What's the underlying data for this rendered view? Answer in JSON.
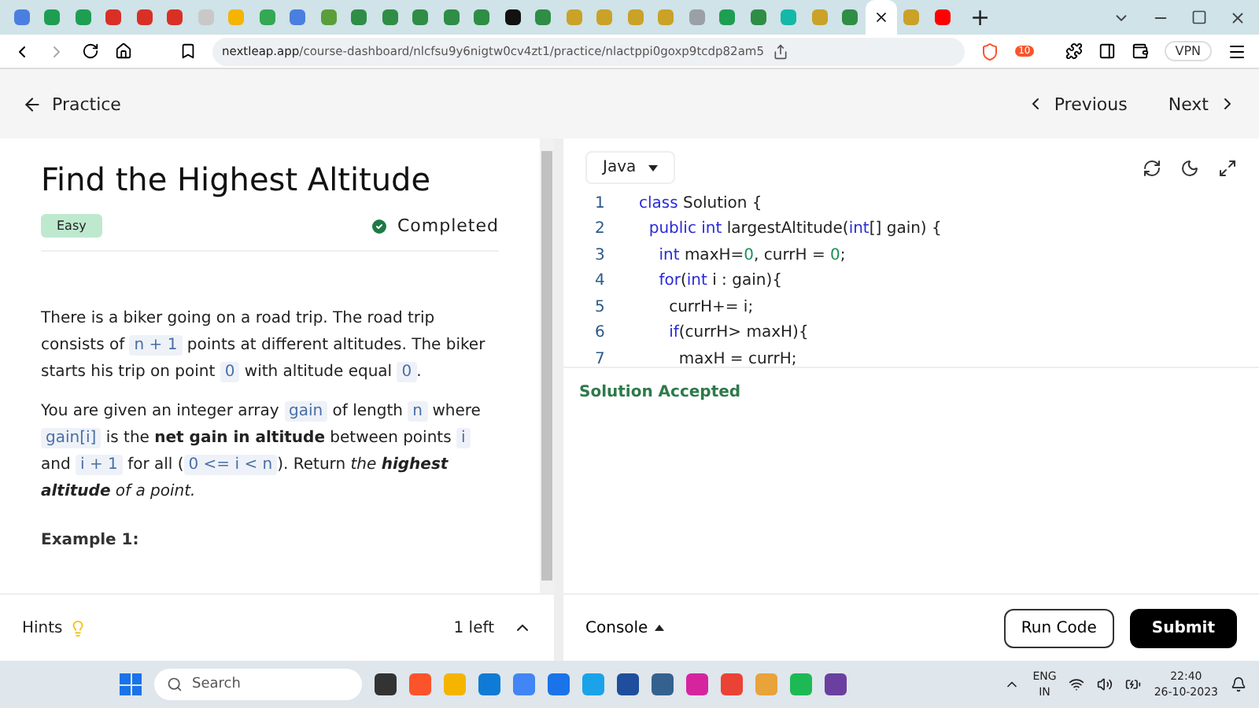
{
  "browser": {
    "tabs": [
      {
        "color": "#4a7fe0",
        "selected": false
      },
      {
        "color": "#1e9e52",
        "selected": false
      },
      {
        "color": "#1e9e52",
        "selected": false
      },
      {
        "color": "#d93025",
        "selected": false
      },
      {
        "color": "#d93025",
        "selected": false
      },
      {
        "color": "#d93025",
        "selected": false
      },
      {
        "color": "#c8c8c8",
        "selected": false
      },
      {
        "color": "#f4b400",
        "selected": false
      },
      {
        "color": "#34a853",
        "selected": false
      },
      {
        "color": "#4a7fe0",
        "selected": false
      },
      {
        "color": "#5a9e3a",
        "selected": false
      },
      {
        "color": "#2f8d46",
        "selected": false
      },
      {
        "color": "#2f8d46",
        "selected": false
      },
      {
        "color": "#2f8d46",
        "selected": false
      },
      {
        "color": "#2f8d46",
        "selected": false
      },
      {
        "color": "#2f8d46",
        "selected": false
      },
      {
        "color": "#111111",
        "selected": false
      },
      {
        "color": "#2f8d46",
        "selected": false
      },
      {
        "color": "#c9a227",
        "selected": false
      },
      {
        "color": "#c9a227",
        "selected": false
      },
      {
        "color": "#c9a227",
        "selected": false
      },
      {
        "color": "#c9a227",
        "selected": false
      },
      {
        "color": "#9aa0a6",
        "selected": false
      },
      {
        "color": "#1e9e52",
        "selected": false
      },
      {
        "color": "#2f8d46",
        "selected": false
      },
      {
        "color": "#14b8a6",
        "selected": false
      },
      {
        "color": "#c9a227",
        "selected": false
      },
      {
        "color": "#2f8d46",
        "selected": false
      },
      {
        "selected": true
      },
      {
        "color": "#c9a227",
        "selected": false
      },
      {
        "color": "#ff0000",
        "selected": false
      }
    ],
    "new_tab": "+",
    "url_host": "nextleap.app",
    "url_path": "/course-dashboard/nlcfsu9y6nigtw0cv4zt1/practice/nlactppi0goxp9tcdp82am5",
    "badge_count": "10",
    "vpn": "VPN"
  },
  "header": {
    "back": "Practice",
    "previous": "Previous",
    "next": "Next"
  },
  "problem": {
    "title": "Find the Highest Altitude",
    "difficulty": "Easy",
    "status": "Completed",
    "paragraphs": [
      [
        {
          "kind": "text",
          "text": "There is a biker going on a road trip. The road trip consists of "
        },
        {
          "kind": "code",
          "text": "n + 1"
        },
        {
          "kind": "text",
          "text": " points at different altitudes. The biker starts his trip on point "
        },
        {
          "kind": "code",
          "text": "0"
        },
        {
          "kind": "text",
          "text": " with altitude equal "
        },
        {
          "kind": "code",
          "text": "0"
        },
        {
          "kind": "text",
          "text": "."
        }
      ],
      [
        {
          "kind": "text",
          "text": "You are given an integer array "
        },
        {
          "kind": "code",
          "text": "gain"
        },
        {
          "kind": "text",
          "text": " of length "
        },
        {
          "kind": "code",
          "text": "n"
        },
        {
          "kind": "text",
          "text": " where "
        },
        {
          "kind": "code",
          "text": "gain[i]"
        },
        {
          "kind": "text",
          "text": " is the **net gain in altitude** between points "
        },
        {
          "kind": "code",
          "text": "i"
        },
        {
          "kind": "text",
          "text": " and "
        },
        {
          "kind": "code",
          "text": "i + 1"
        },
        {
          "kind": "text",
          "text": " for all ("
        },
        {
          "kind": "code",
          "text": "0 <= i < n"
        },
        {
          "kind": "text",
          "text": "). Return *the* "
        },
        {
          "kind": "strong",
          "text": "highest altitude"
        },
        {
          "kind": "text",
          "text": " *of a point.*"
        }
      ]
    ],
    "example_heading": "Example 1:"
  },
  "hints": {
    "label": "Hints",
    "count": "1 left"
  },
  "editor": {
    "language": "Java",
    "lines": [
      {
        "number": "1",
        "tokens": [
          {
            "kind": "keyword",
            "text": "class"
          },
          {
            "kind": "plain",
            "text": " Solution {"
          }
        ]
      },
      {
        "number": "2",
        "tokens": [
          {
            "kind": "keyword",
            "text": "  public int"
          },
          {
            "kind": "plain",
            "text": " largestAltitude("
          },
          {
            "kind": "keyword",
            "text": "int"
          },
          {
            "kind": "plain",
            "text": "[] gain) {"
          }
        ]
      },
      {
        "number": "3",
        "tokens": [
          {
            "kind": "keyword",
            "text": "    int"
          },
          {
            "kind": "plain",
            "text": " maxH="
          },
          {
            "kind": "number",
            "text": "0"
          },
          {
            "kind": "plain",
            "text": ", currH = "
          },
          {
            "kind": "number",
            "text": "0"
          },
          {
            "kind": "plain",
            "text": ";"
          }
        ]
      },
      {
        "number": "4",
        "tokens": [
          {
            "kind": "keyword",
            "text": "    for"
          },
          {
            "kind": "plain",
            "text": "("
          },
          {
            "kind": "keyword",
            "text": "int"
          },
          {
            "kind": "plain",
            "text": " i : gain){"
          }
        ]
      },
      {
        "number": "5",
        "tokens": [
          {
            "kind": "plain",
            "text": "      currH+= i;"
          }
        ]
      },
      {
        "number": "6",
        "tokens": [
          {
            "kind": "keyword",
            "text": "      if"
          },
          {
            "kind": "plain",
            "text": "(currH> maxH){"
          }
        ]
      },
      {
        "number": "7",
        "tokens": [
          {
            "kind": "plain",
            "text": "        maxH = currH;"
          }
        ]
      }
    ]
  },
  "console": {
    "result": "Solution Accepted",
    "label": "Console",
    "run": "Run Code",
    "submit": "Submit"
  },
  "taskbar": {
    "search": "Search",
    "apps": [
      {
        "color": "#333333"
      },
      {
        "color": "#fb542b"
      },
      {
        "color": "#f4b400"
      },
      {
        "color": "#0f7bd6"
      },
      {
        "color": "#4285f4"
      },
      {
        "color": "#1a73e8"
      },
      {
        "color": "#1aa3e8"
      },
      {
        "color": "#1f4e9c"
      },
      {
        "color": "#35618f"
      },
      {
        "color": "#d6249f"
      },
      {
        "color": "#ea4335"
      },
      {
        "color": "#e8a33a"
      },
      {
        "color": "#1db954"
      },
      {
        "color": "#6b3fa0"
      }
    ],
    "lang": "ENG",
    "region": "IN",
    "time": "22:40",
    "date": "26-10-2023"
  }
}
